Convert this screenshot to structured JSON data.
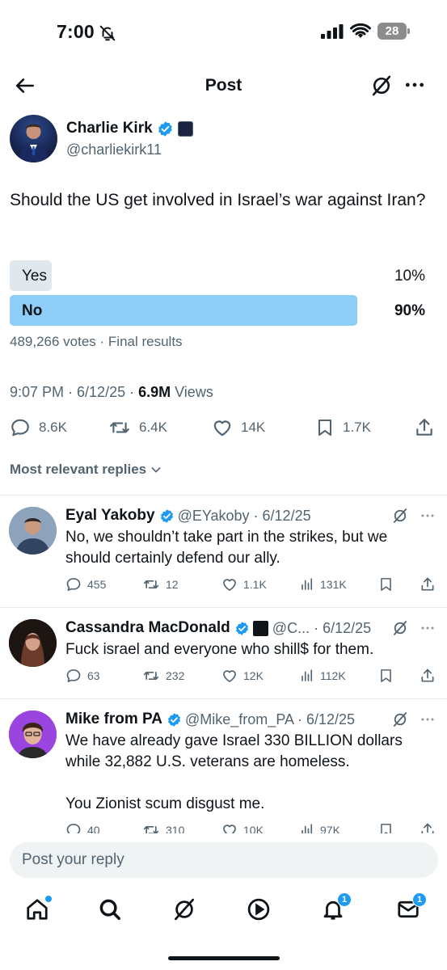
{
  "status_bar": {
    "time": "7:00",
    "battery": "28"
  },
  "header": {
    "title": "Post"
  },
  "tweet": {
    "author_name": "Charlie Kirk",
    "author_handle": "@charliekirk11",
    "text": "Should the US get involved in Israel’s war against Iran?",
    "poll": {
      "options": [
        {
          "label": "Yes",
          "percent_label": "10%",
          "percent": 10,
          "winner": false
        },
        {
          "label": "No",
          "percent_label": "90%",
          "percent": 90,
          "winner": true
        }
      ],
      "meta": "489,266 votes · Final results"
    },
    "timestamp": "9:07 PM · 6/12/25 · ",
    "views_count": "6.9M",
    "views_label": " Views",
    "stats": {
      "replies": "8.6K",
      "reposts": "6.4K",
      "likes": "14K",
      "bookmarks": "1.7K"
    }
  },
  "replies_filter": "Most relevant replies",
  "replies": [
    {
      "name": "Eyal Yakoby",
      "handle_date": "@EYakoby · 6/12/25",
      "text": "No, we shouldn’t take part in the strikes, but we should certainly defend our ally.",
      "stats": {
        "replies": "455",
        "reposts": "12",
        "likes": "1.1K",
        "views": "131K"
      }
    },
    {
      "name": "Cassandra MacDonald",
      "handle_date": "@C... · 6/12/25",
      "text": "Fuck israel and everyone who shill$ for them.",
      "stats": {
        "replies": "63",
        "reposts": "232",
        "likes": "12K",
        "views": "112K"
      }
    },
    {
      "name": "Mike from PA",
      "handle_date": "@Mike_from_PA · 6/12/25",
      "text": "We have already gave Israel 330 BILLION dollars while 32,882 U.S. veterans are homeless.\n\nYou Zionist scum disgust me.",
      "stats": {
        "replies": "40",
        "reposts": "310",
        "likes": "10K",
        "views": "97K"
      }
    }
  ],
  "composer": {
    "placeholder": "Post your reply"
  },
  "nav": {
    "notifications_badge": "1",
    "messages_badge": "1"
  },
  "colors": {
    "accent": "#1d9bf0",
    "poll_winner": "#8ecdf8",
    "poll_other": "#cfd9de",
    "text_secondary": "#536471"
  }
}
